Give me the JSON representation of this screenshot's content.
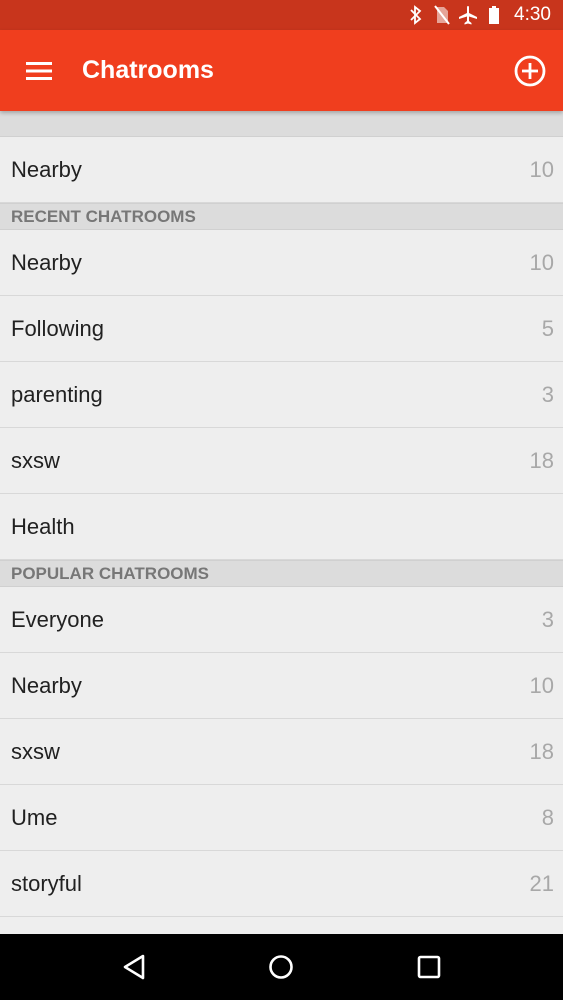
{
  "status_bar": {
    "time": "4:30",
    "icons": [
      "bluetooth-icon",
      "no-sim-icon",
      "airplane-icon",
      "battery-icon"
    ]
  },
  "app_bar": {
    "title": "Chatrooms",
    "menu_icon": "hamburger-menu-icon",
    "action_icon": "add-circle-icon",
    "background": "#f03e1e",
    "status_background": "#c8351c"
  },
  "top_item": {
    "label": "Nearby",
    "count": "10"
  },
  "recent": {
    "header": "RECENT CHATROOMS",
    "items": [
      {
        "label": "Nearby",
        "count": "10"
      },
      {
        "label": "Following",
        "count": "5"
      },
      {
        "label": "parenting",
        "count": "3"
      },
      {
        "label": "sxsw",
        "count": "18"
      },
      {
        "label": "Health",
        "count": ""
      }
    ]
  },
  "popular": {
    "header": "POPULAR CHATROOMS",
    "items": [
      {
        "label": "Everyone",
        "count": "3"
      },
      {
        "label": "Nearby",
        "count": "10"
      },
      {
        "label": "sxsw",
        "count": "18"
      },
      {
        "label": "Ume",
        "count": "8"
      },
      {
        "label": "storyful",
        "count": "21"
      }
    ]
  },
  "nav_bar": {
    "icons": [
      "back-icon",
      "home-icon",
      "recents-icon"
    ]
  }
}
